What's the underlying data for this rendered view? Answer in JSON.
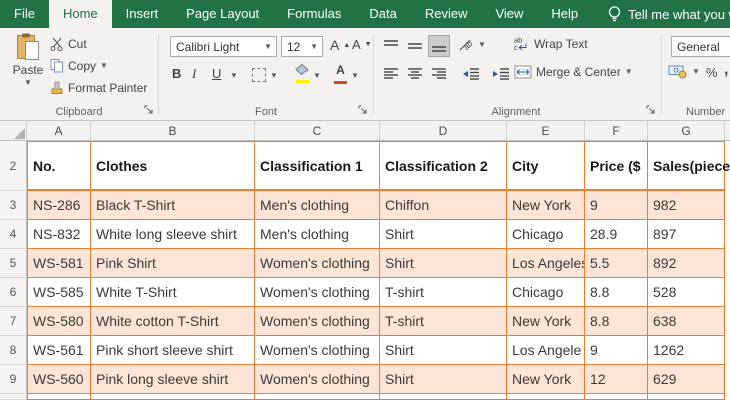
{
  "window": {
    "tell_me": "Tell me what you want to"
  },
  "ribbon": {
    "tabs": [
      {
        "label": "File",
        "active": false
      },
      {
        "label": "Home",
        "active": true
      },
      {
        "label": "Insert",
        "active": false
      },
      {
        "label": "Page Layout",
        "active": false
      },
      {
        "label": "Formulas",
        "active": false
      },
      {
        "label": "Data",
        "active": false
      },
      {
        "label": "Review",
        "active": false
      },
      {
        "label": "View",
        "active": false
      },
      {
        "label": "Help",
        "active": false
      }
    ],
    "clipboard": {
      "group_label": "Clipboard",
      "paste_label": "Paste",
      "cut_label": "Cut",
      "copy_label": "Copy",
      "format_painter_label": "Format Painter"
    },
    "font": {
      "group_label": "Font",
      "font_name": "Calibri Light",
      "font_size": "12",
      "bold_label": "B",
      "italic_label": "I",
      "underline_label": "U"
    },
    "alignment": {
      "group_label": "Alignment",
      "wrap_text_label": "Wrap Text",
      "merge_center_label": "Merge & Center"
    },
    "number": {
      "group_label": "Number",
      "format_value": "General",
      "percent_label": "%",
      "comma_label": ","
    }
  },
  "sheet": {
    "column_headers": [
      "A",
      "B",
      "C",
      "D",
      "E",
      "F",
      "G"
    ],
    "rows": [
      {
        "num": "2",
        "is_header": true,
        "shaded": false,
        "cells": [
          "No.",
          "Clothes",
          "Classification 1",
          "Classification 2",
          "City",
          "Price ($",
          "Sales(piece"
        ]
      },
      {
        "num": "3",
        "is_header": false,
        "shaded": true,
        "cells": [
          "NS-286",
          "Black T-Shirt",
          "Men's clothing",
          "Chiffon",
          "New York",
          "9",
          "982"
        ]
      },
      {
        "num": "4",
        "is_header": false,
        "shaded": false,
        "cells": [
          "NS-832",
          "White long sleeve shirt",
          "Men's clothing",
          "Shirt",
          "Chicago",
          "28.9",
          "897"
        ]
      },
      {
        "num": "5",
        "is_header": false,
        "shaded": true,
        "cells": [
          "WS-581",
          "Pink Shirt",
          "Women's clothing",
          "Shirt",
          "Los Angeles",
          "5.5",
          "892"
        ]
      },
      {
        "num": "6",
        "is_header": false,
        "shaded": false,
        "cells": [
          "WS-585",
          "White T-Shirt",
          "Women's clothing",
          "T-shirt",
          "Chicago",
          "8.8",
          "528"
        ]
      },
      {
        "num": "7",
        "is_header": false,
        "shaded": true,
        "cells": [
          "WS-580",
          "White cotton T-Shirt",
          "Women's clothing",
          "T-shirt",
          "New York",
          "8.8",
          "638"
        ]
      },
      {
        "num": "8",
        "is_header": false,
        "shaded": false,
        "cells": [
          "WS-561",
          "Pink short sleeve shirt",
          "Women's clothing",
          "Shirt",
          "Los Angele",
          "9",
          "1262"
        ]
      },
      {
        "num": "9",
        "is_header": false,
        "shaded": true,
        "cells": [
          "WS-560",
          "Pink long sleeve shirt",
          "Women's clothing",
          "Shirt",
          "New York",
          "12",
          "629"
        ]
      },
      {
        "num": "",
        "is_header": false,
        "shaded": false,
        "partial": true,
        "cells": [
          "",
          "",
          "",
          "",
          "",
          "",
          ""
        ]
      }
    ]
  },
  "colors": {
    "accent_green": "#217346",
    "table_border": "#ED7D31",
    "shaded_row_fill": "#FCE4D6",
    "fill_color_swatch": "#FFF000",
    "font_color_swatch": "#D14A24"
  }
}
